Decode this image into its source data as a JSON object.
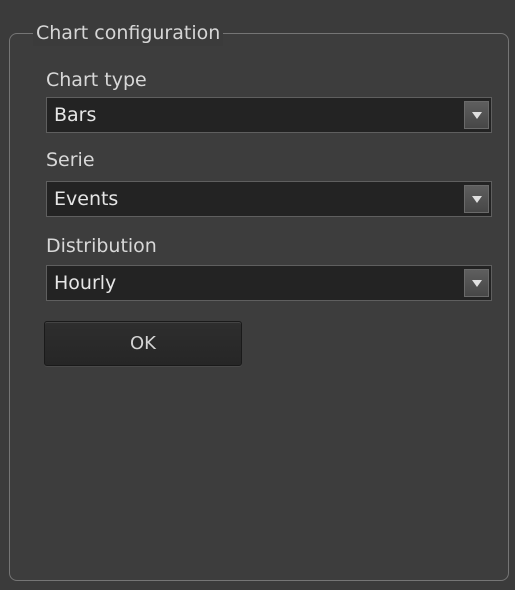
{
  "panel": {
    "title": "Chart configuration"
  },
  "fields": {
    "chart_type": {
      "label": "Chart type",
      "value": "Bars"
    },
    "serie": {
      "label": "Serie",
      "value": "Events"
    },
    "distribution": {
      "label": "Distribution",
      "value": "Hourly"
    }
  },
  "buttons": {
    "ok_label": "OK"
  },
  "icons": {
    "dropdown": "chevron-down-icon"
  },
  "colors": {
    "background": "#3b3b3b",
    "field_background": "#232323",
    "text": "#d8d8d8"
  }
}
